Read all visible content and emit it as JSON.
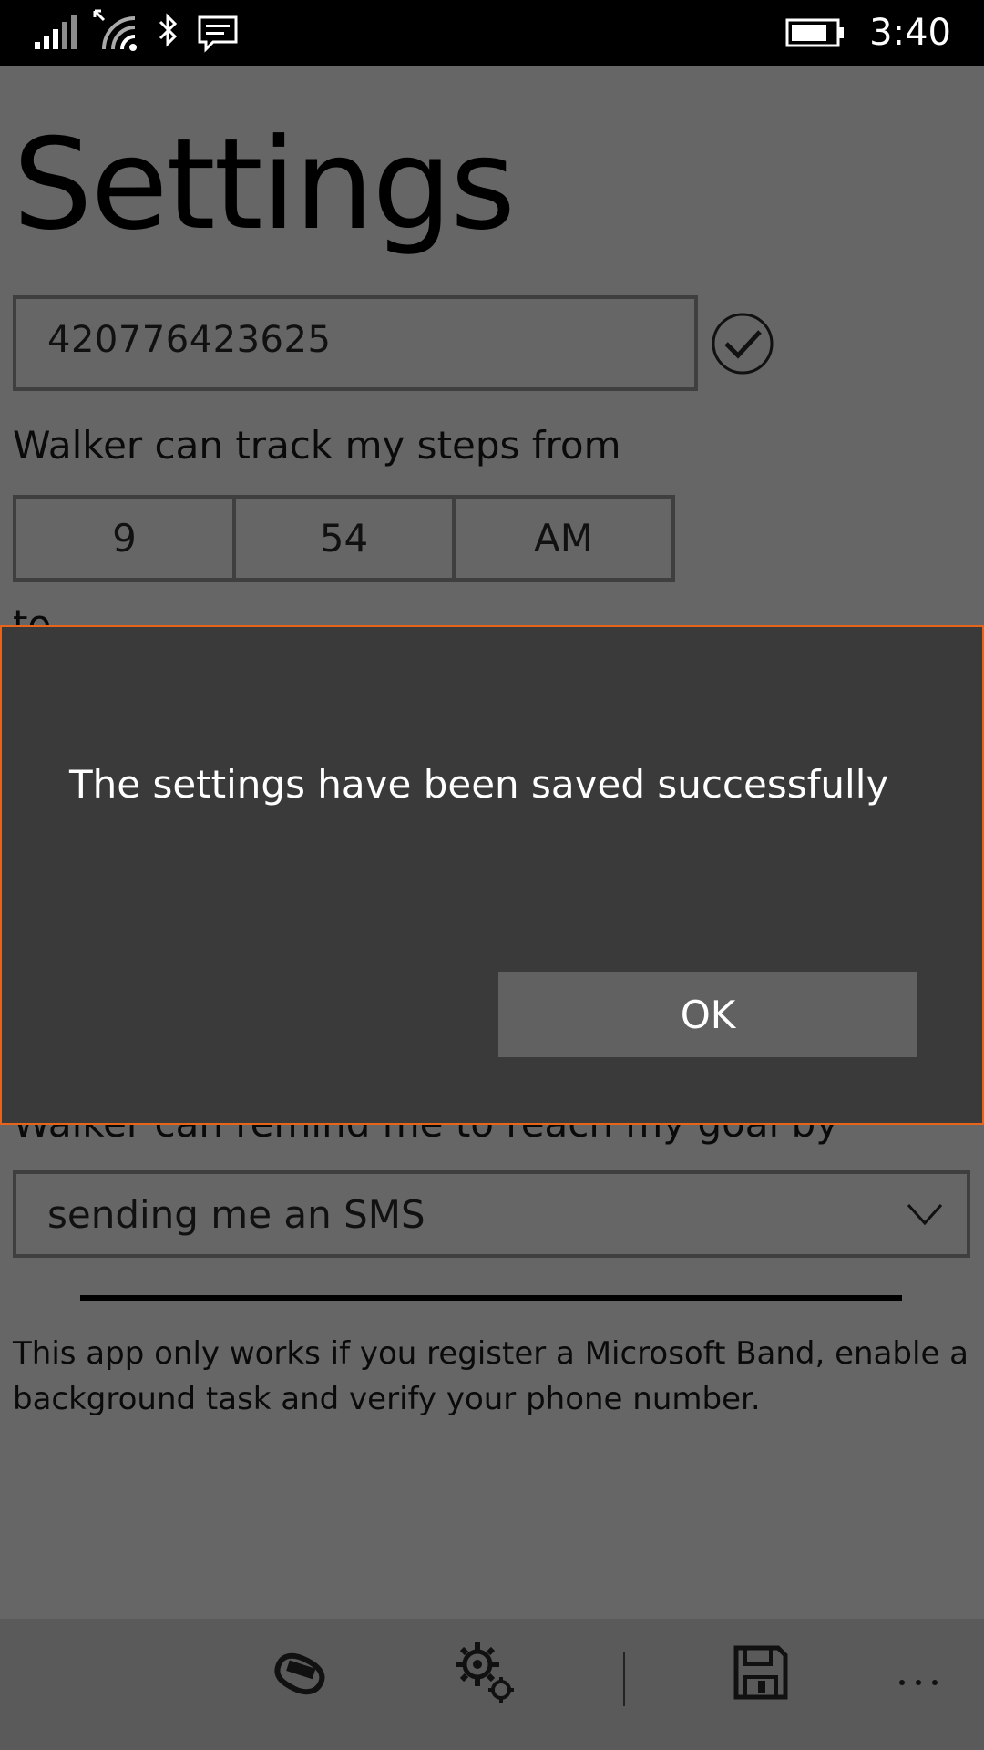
{
  "status_bar": {
    "time": "3:40",
    "icons": [
      "signal-icon",
      "wifi-icon",
      "bluetooth-icon",
      "message-icon",
      "battery-icon"
    ]
  },
  "page": {
    "title": "Settings",
    "phone_number": "420776423625",
    "track_from_label": "Walker can track my steps from",
    "from_time": {
      "hour": "9",
      "minute": "54",
      "ampm": "AM"
    },
    "to_label": "to",
    "remind_label": "Walker can remind me to reach my goal by",
    "remind_option": "sending me an SMS",
    "info_text": "This app only works if you register a Microsoft Band, enable a background task and verify your phone number."
  },
  "dialog": {
    "message": "The settings have been saved successfully",
    "ok_label": "OK"
  },
  "app_bar": {
    "buttons": [
      "band-icon",
      "settings-icon",
      "save-icon"
    ],
    "more": "..."
  },
  "colors": {
    "dialog_border": "#e8641b",
    "dialog_bg": "#3a3a3a",
    "page_bg": "#666666"
  }
}
